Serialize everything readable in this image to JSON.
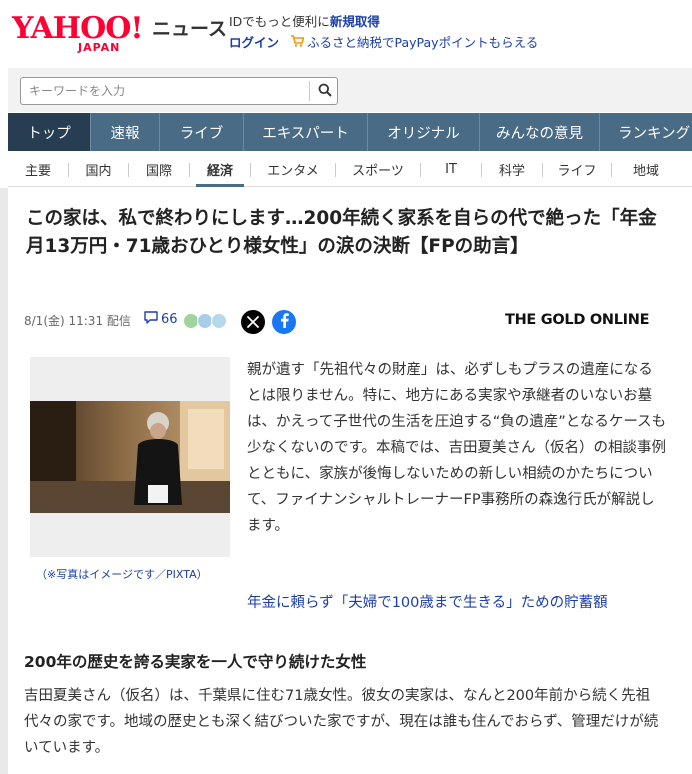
{
  "header": {
    "logo_text": "YAHOO!",
    "logo_sub": "JAPAN",
    "section_title": "ニュース",
    "promo_text": "IDでもっと便利に",
    "register_label": "新規取得",
    "login_label": "ログイン",
    "furusato_label": "ふるさと納税でPayPayポイントもらえる"
  },
  "search": {
    "placeholder": "キーワードを入力"
  },
  "nav_primary": [
    {
      "label": "トップ"
    },
    {
      "label": "速報"
    },
    {
      "label": "ライブ"
    },
    {
      "label": "エキスパート"
    },
    {
      "label": "オリジナル"
    },
    {
      "label": "みんなの意見"
    },
    {
      "label": "ランキング"
    }
  ],
  "nav_secondary": [
    {
      "label": "主要"
    },
    {
      "label": "国内"
    },
    {
      "label": "国際"
    },
    {
      "label": "経済"
    },
    {
      "label": "エンタメ"
    },
    {
      "label": "スポーツ"
    },
    {
      "label": "IT"
    },
    {
      "label": "科学"
    },
    {
      "label": "ライフ"
    },
    {
      "label": "地域"
    }
  ],
  "article": {
    "title": "この家は、私で終わりにします…200年続く家系を自らの代で絶った「年金月13万円・71歳おひとり様女性」の涙の決断【FPの助言】",
    "date": "8/1(金) 11:31 配信",
    "comment_count": "66",
    "publisher": "THE GOLD ONLINE",
    "photo_caption": "（※写真はイメージです／PIXTA）",
    "lead": "親が遺す「先祖代々の財産」は、必ずしもプラスの遺産になるとは限りません。特に、地方にある実家や承継者のいないお墓は、かえって子世代の生活を圧迫する“負の遺産”となるケースも少なくないのです。本稿では、吉田夏美さん（仮名）の相談事例とともに、家族が後悔しないための新しい相続のかたちについて、ファイナンシャルトレーナーFP事務所の森逸行氏が解説します。",
    "related_link": "年金に頼らず「夫婦で100歳まで生きる」ための貯蓄額",
    "section_heading": "200年の歴史を誇る実家を一人で守り続けた女性",
    "body": "吉田夏美さん（仮名）は、千葉県に住む71歳女性。彼女の実家は、なんと200年前から続く先祖代々の家です。地域の歴史とも深く結びついた家ですが、現在は誰も住んでおらず、管理だけが続いています。"
  },
  "colors": {
    "brand_red": "#ff0033",
    "nav_bg": "#4a6b85",
    "nav_active": "#273d52",
    "link_blue": "#1b3fa8",
    "facebook_blue": "#1877f2"
  }
}
